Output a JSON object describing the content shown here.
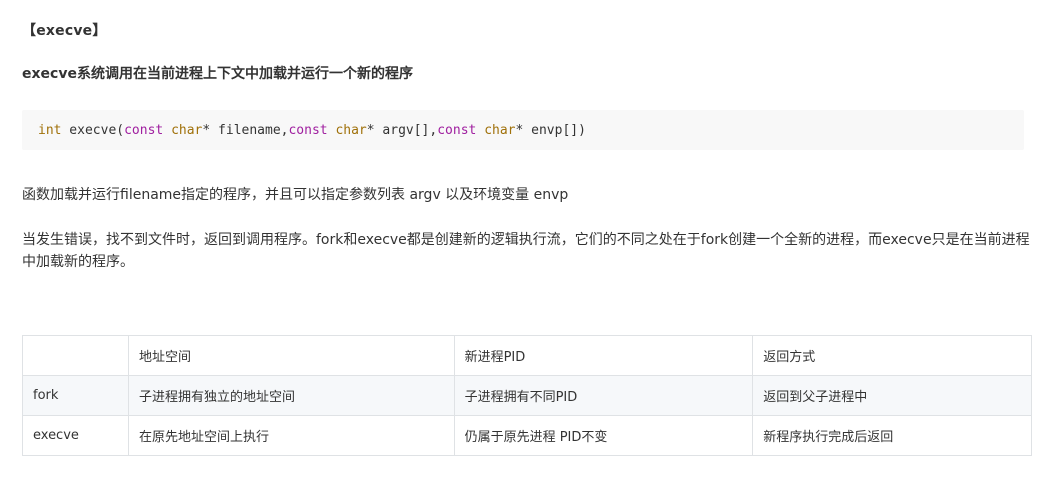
{
  "header": {
    "title": "【execve】",
    "subtitle": "execve系统调用在当前进程上下文中加载并运行一个新的程序"
  },
  "code": {
    "t1": "int",
    "t2": " execve(",
    "t3": "const",
    "t4": " ",
    "t5": "char",
    "t6": "* filename,",
    "t7": "const",
    "t8": " ",
    "t9": "char",
    "t10": "* argv[],",
    "t11": "const",
    "t12": " ",
    "t13": "char",
    "t14": "* envp[])"
  },
  "paragraphs": {
    "p1": "函数加载并运行filename指定的程序，并且可以指定参数列表 argv  以及环境变量 envp",
    "p2": "当发生错误，找不到文件时，返回到调用程序。fork和execve都是创建新的逻辑执行流，它们的不同之处在于fork创建一个全新的进程，而execve只是在当前进程中加载新的程序。"
  },
  "table": {
    "headers": [
      "",
      "地址空间",
      "新进程PID",
      "返回方式"
    ],
    "rows": [
      [
        "fork",
        "子进程拥有独立的地址空间",
        "子进程拥有不同PID",
        "返回到父子进程中"
      ],
      [
        "execve",
        "在原先地址空间上执行",
        "仍属于原先进程 PID不变",
        "新程序执行完成后返回"
      ]
    ]
  },
  "colors": {
    "text": "#333333",
    "code_background": "#f8f8f8",
    "code_type": "#a0710a",
    "code_keyword": "#a020a0",
    "table_border": "#dfe2e5",
    "table_alt_row": "#f6f8fa"
  }
}
